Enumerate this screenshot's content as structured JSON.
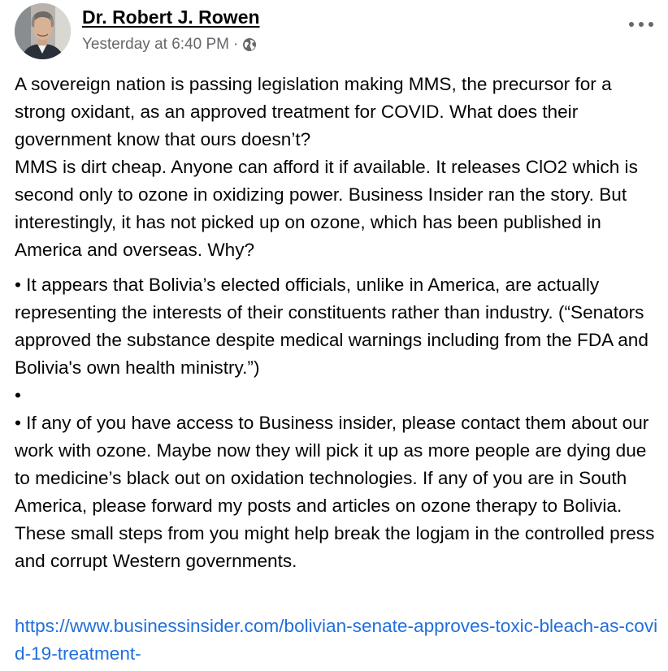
{
  "post": {
    "author_name": "Dr. Robert J. Rowen",
    "timestamp": "Yesterday at 6:40 PM",
    "separator": "·",
    "privacy_icon": "globe-icon",
    "more_icon": "more-options-icon"
  },
  "body": {
    "paragraph_1": "A sovereign nation is passing legislation making MMS, the precursor for a strong oxidant, as an approved treatment for COVID. What does their government know that ours doesn’t?\nMMS is dirt cheap. Anyone can afford it if available. It releases ClO2 which is second only to ozone in oxidizing power. Business Insider ran the story. But interestingly, it has not picked up on ozone, which has been published in America and overseas.  Why?",
    "paragraph_2": "• It appears that Bolivia’s elected officials, unlike in America, are actually representing the interests of their constituents rather than industry. (“Senators approved the substance despite medical warnings including from the FDA and Bolivia's own health ministry.”)\n•\n•  If any of you have access to Business insider, please contact them about our work with ozone. Maybe now they will pick it up as more people are dying due to medicine’s black out on oxidation technologies. If any of you are in South America, please forward my posts and articles on ozone therapy to Bolivia. These small steps from you might help break the logjam in the controlled press and corrupt Western governments.",
    "link_text": "https://www.businessinsider.com/bolivian-senate-approves-toxic-bleach-as-covid-19-treatment-"
  },
  "colors": {
    "text": "#050505",
    "meta_text": "#65676b",
    "link": "#216fdb",
    "background": "#ffffff"
  }
}
